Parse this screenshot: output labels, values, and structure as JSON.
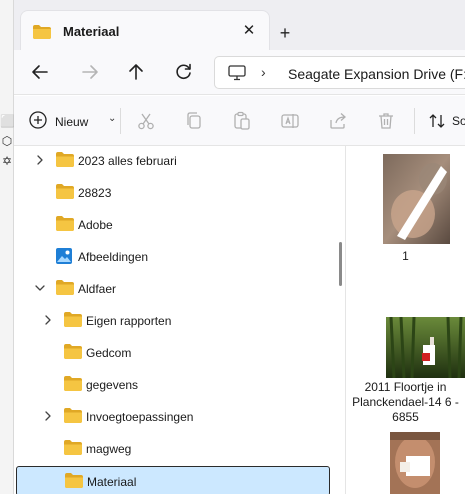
{
  "window": {
    "tab_title": "Materiaal"
  },
  "address": {
    "breadcrumb": "Seagate Expansion Drive (F:)"
  },
  "toolbar": {
    "new_label": "Nieuw",
    "sort_label": "So"
  },
  "left_strip": {
    "glyphs": [
      "⬡",
      "✡"
    ]
  },
  "nav": {
    "items": [
      {
        "label": "2023 alles februari",
        "expander": "collapsed",
        "icon": "folder-icon",
        "depth": 0
      },
      {
        "label": "28823",
        "expander": "none",
        "icon": "folder-icon",
        "depth": 0
      },
      {
        "label": "Adobe",
        "expander": "none",
        "icon": "folder-icon",
        "depth": 0
      },
      {
        "label": "Afbeeldingen",
        "expander": "none",
        "icon": "pictures-icon",
        "depth": 0
      },
      {
        "label": "Aldfaer",
        "expander": "expanded",
        "icon": "folder-icon",
        "depth": 0
      },
      {
        "label": "Eigen rapporten",
        "expander": "collapsed",
        "icon": "folder-icon",
        "depth": 1
      },
      {
        "label": "Gedcom",
        "expander": "none",
        "icon": "folder-icon",
        "depth": 1
      },
      {
        "label": "gegevens",
        "expander": "none",
        "icon": "folder-icon",
        "depth": 1
      },
      {
        "label": "Invoegtoepassingen",
        "expander": "collapsed",
        "icon": "folder-icon",
        "depth": 1
      },
      {
        "label": "magweg",
        "expander": "none",
        "icon": "folder-icon",
        "depth": 1
      },
      {
        "label": "Materiaal",
        "expander": "none",
        "icon": "folder-icon",
        "depth": 1,
        "selected": true
      }
    ]
  },
  "files": [
    {
      "label": "1"
    },
    {
      "label": "2011 Floortje in Planckendael-14 6 - 6855"
    },
    {
      "label": ""
    }
  ],
  "colors": {
    "folder": "#f5c542",
    "folder_dark": "#e0a825",
    "selection": "#cce8ff",
    "accent": "#0067c0"
  }
}
